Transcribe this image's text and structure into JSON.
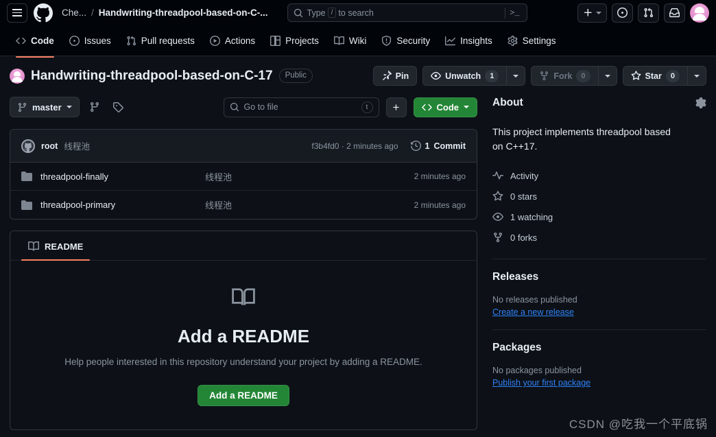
{
  "header": {
    "menu_icon": "hamburger-icon",
    "logo_icon": "github-logo-icon",
    "breadcrumb_owner": "Che...",
    "breadcrumb_sep": "/",
    "breadcrumb_repo": "Handwriting-threadpool-based-on-C-...",
    "search_placeholder": "Type",
    "search_key": "/",
    "search_placeholder_tail": "to search",
    "terminal_glyph": ">_",
    "create_label": "+",
    "issues_icon": "issue-opened-icon",
    "pulls_icon": "git-pull-request-icon",
    "inbox_icon": "inbox-icon",
    "avatar_name": "user-avatar"
  },
  "repo_nav": [
    {
      "label": "Code",
      "icon": "code-icon",
      "active": true
    },
    {
      "label": "Issues",
      "icon": "issue-opened-icon",
      "active": false
    },
    {
      "label": "Pull requests",
      "icon": "git-pull-request-icon",
      "active": false
    },
    {
      "label": "Actions",
      "icon": "play-icon",
      "active": false
    },
    {
      "label": "Projects",
      "icon": "table-icon",
      "active": false
    },
    {
      "label": "Wiki",
      "icon": "book-icon",
      "active": false
    },
    {
      "label": "Security",
      "icon": "shield-icon",
      "active": false
    },
    {
      "label": "Insights",
      "icon": "graph-icon",
      "active": false
    },
    {
      "label": "Settings",
      "icon": "gear-icon",
      "active": false
    }
  ],
  "repo": {
    "name": "Handwriting-threadpool-based-on-C-17",
    "visibility": "Public",
    "pin_label": "Pin",
    "watch_label": "Unwatch",
    "watch_count": "1",
    "fork_label": "Fork",
    "fork_count": "0",
    "star_label": "Star",
    "star_count": "0"
  },
  "code_toolbar": {
    "branch": "master",
    "branches_icon": "git-branch-icon",
    "tags_icon": "tag-icon",
    "goto_file_placeholder": "Go to file",
    "goto_file_key": "t",
    "add_file_label": "+",
    "code_button_label": "Code",
    "accent_green": "#238636"
  },
  "commit_bar": {
    "author": "root",
    "message": "线程池",
    "hash_and_time": "f3b4fd0 · 2 minutes ago",
    "commit_count": "1",
    "commit_count_label": "Commit",
    "history_icon": "history-icon"
  },
  "files": [
    {
      "icon": "folder-icon",
      "name": "threadpool-finally",
      "message": "线程池",
      "time": "2 minutes ago"
    },
    {
      "icon": "folder-icon",
      "name": "threadpool-primary",
      "message": "线程池",
      "time": "2 minutes ago"
    }
  ],
  "readme": {
    "tab_label": "README",
    "tab_icon": "book-icon",
    "empty_icon": "book-icon",
    "title": "Add a README",
    "subtitle": "Help people interested in this repository understand your project by adding a README.",
    "button_label": "Add a README",
    "underline_color": "#f78166"
  },
  "about": {
    "title": "About",
    "settings_icon": "gear-icon",
    "description": "This project implements threadpool based on C++17.",
    "stats": [
      {
        "icon": "pulse-icon",
        "label": "Activity"
      },
      {
        "icon": "star-icon",
        "label": "0 stars"
      },
      {
        "icon": "eye-icon",
        "label": "1 watching"
      },
      {
        "icon": "repo-forked-icon",
        "label": "0 forks"
      }
    ]
  },
  "releases": {
    "title": "Releases",
    "empty": "No releases published",
    "link": "Create a new release"
  },
  "packages": {
    "title": "Packages",
    "empty": "No packages published",
    "link": "Publish your first package"
  },
  "watermark": "CSDN @吃我一个平底锅"
}
